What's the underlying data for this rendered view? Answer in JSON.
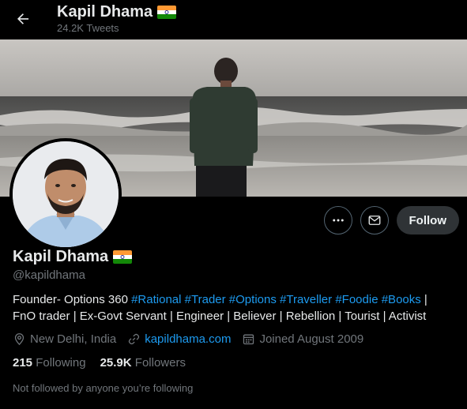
{
  "header": {
    "name": "Kapil Dhama",
    "tweets": "24.2K Tweets"
  },
  "profile": {
    "name": "Kapil Dhama",
    "handle": "@kapildhama",
    "bio_plain_1": "Founder- Options 360 ",
    "bio_tags": [
      "#Rational",
      "#Trader",
      "#Options",
      "#Traveller",
      "#Foodie",
      "#Books"
    ],
    "bio_after_tags": " |",
    "bio_line_2": "FnO trader | Ex-Govt Servant | Engineer | Believer | Rebellion | Tourist | Activist",
    "location": "New Delhi, India",
    "website": "kapildhama.com",
    "joined": "Joined August 2009",
    "following_count": "215",
    "following_label": "Following",
    "followers_count": "25.9K",
    "followers_label": "Followers",
    "not_followed": "Not followed by anyone you’re following"
  },
  "actions": {
    "follow_label": "Follow"
  },
  "icons": {
    "back": "back-arrow-icon",
    "more": "more-dots-icon",
    "message": "envelope-icon",
    "location": "location-pin-icon",
    "link": "link-icon",
    "calendar": "calendar-icon",
    "flag": "india-flag-icon"
  },
  "colors": {
    "accent": "#1d9bf0",
    "muted": "#71767b",
    "text": "#e7e9ea",
    "follow_bg": "#2f3336"
  }
}
